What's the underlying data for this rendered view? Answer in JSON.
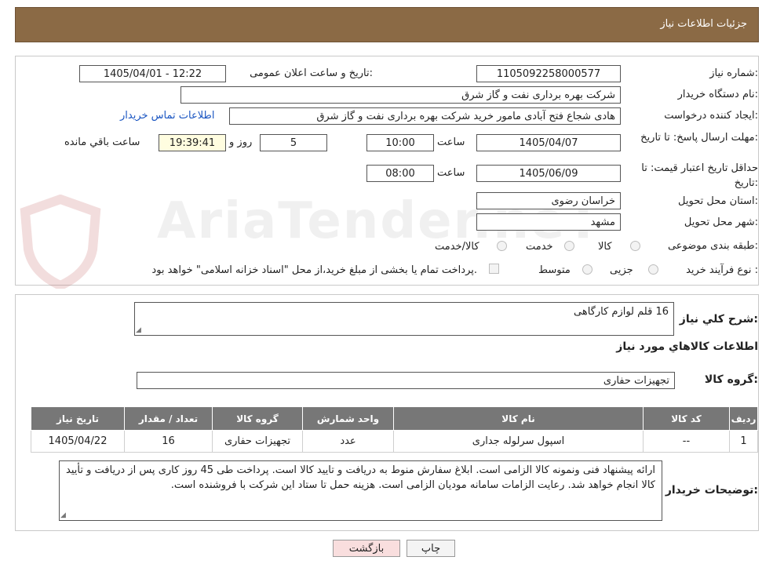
{
  "header": {
    "title": "جزئیات اطلاعات نیاز"
  },
  "form": {
    "need_number_label": "شماره نیاز:",
    "need_number": "1105092258000577",
    "announce_label": "تاریخ و ساعت اعلان عمومی:",
    "announce_value": "1405/04/01 - 12:22",
    "buyer_org_label": "نام دستگاه خریدار:",
    "buyer_org": "شرکت بهره برداری نفت و گاز شرق",
    "creator_label": "ایجاد کننده درخواست:",
    "creator": "هادی شجاع فتح آبادی مامور خرید شرکت بهره برداری نفت و گاز شرق",
    "contact_link": "اطلاعات تماس خریدار",
    "deadline_label": "مهلت ارسال پاسخ: تا تاریخ:",
    "deadline_date": "1405/04/07",
    "time_label": "ساعت",
    "deadline_time": "10:00",
    "days_value": "5",
    "day_word": "روز و",
    "remaining_time": "19:39:41",
    "remaining_label": "ساعت باقي مانده",
    "validity_label": "حداقل تاریخ اعتبار قیمت: تا تاریخ:",
    "validity_date": "1405/06/09",
    "validity_time": "08:00",
    "province_label": "استان محل تحویل:",
    "province": "خراسان رضوی",
    "city_label": "شهر محل تحویل:",
    "city": "مشهد",
    "category_label": "طبقه بندی موضوعی:",
    "category_options": [
      "کالا",
      "خدمت",
      "کالا/خدمت"
    ],
    "process_label": "نوع فرآیند خرید :",
    "process_options": [
      "جزیی",
      "متوسط"
    ],
    "payment_note": "پرداخت تمام یا بخشی از مبلغ خرید،از محل \"اسناد خزانه اسلامی\" خواهد بود."
  },
  "summary": {
    "label": "شرح كلي نياز:",
    "value": "16 قلم لوازم کارگاهی",
    "items_title": "اطلاعات كالاهاي مورد نياز",
    "group_label": "گروه کالا:",
    "group_value": "تجهیزات حفاری"
  },
  "table": {
    "headers": [
      "ردیف",
      "کد کالا",
      "نام کالا",
      "واحد شمارش",
      "گروه کالا",
      "تعداد / مقدار",
      "تاریخ نیاز"
    ],
    "rows": [
      [
        "1",
        "--",
        "اسپول سرلوله جداری",
        "عدد",
        "تجهیزات حفاری",
        "16",
        "1405/04/22"
      ]
    ]
  },
  "notes": {
    "label": "توضیحات خریدار:",
    "text": "ارائه پیشنهاد فنی ونمونه کالا الزامی است. ابلاغ سفارش منوط به دریافت و تایید کالا است. پرداخت طی  45 روز کاری پس از دریافت و تأیید کالا انجام خواهد شد. رعایت الزامات سامانه مودیان الزامی است. هزینه حمل تا ستاد این شرکت با فروشنده است."
  },
  "buttons": {
    "print": "چاپ",
    "back": "بازگشت"
  },
  "watermark": "AriaTender.neT",
  "colors": {
    "header": "#8b6a45",
    "table_header": "#777777",
    "link": "#1b56c2",
    "back_button": "#f9dede"
  }
}
